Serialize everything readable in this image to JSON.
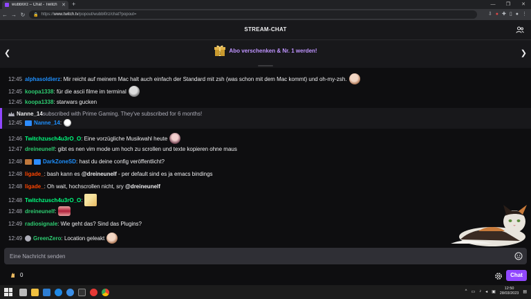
{
  "browser": {
    "tab_title": "wubbl0rz – Chat - Twitch",
    "url_prefix": "https://",
    "url_host": "www.twitch.tv",
    "url_path": "/popout/wubbl0rz/chat?popout="
  },
  "header": {
    "title": "STREAM-CHAT"
  },
  "promo": {
    "text": "Abo verschenken & Nr. 1 werden!"
  },
  "messages": [
    {
      "time": "12:45",
      "user": "alphasoldierz",
      "color": "#1e90ff",
      "text": ": Mir reicht auf meinem Mac halt auch einfach der Standard mit zsh (was schon mit dem Mac kommt) und oh-my-zsh.",
      "emote": "wojak-emote"
    },
    {
      "time": "12:45",
      "user": "koopa1338",
      "color": "#2ecc71",
      "text": ": für die ascii filme im terminal",
      "emote": "pepe-emote"
    },
    {
      "time": "12:45",
      "user": "koopa1338",
      "color": "#2ecc71",
      "text": ": starwars gucken"
    },
    {
      "time": "12:45",
      "user": "Nanne_14",
      "color": "#1e90ff",
      "text": ":",
      "emote": "skull-emote"
    },
    {
      "time": "12:46",
      "user": "Twitchzusch4u3rO_O",
      "color": "#00ff7f",
      "text": ": Eine vorzügliche Musikwahl heute",
      "emote": "anime-emote"
    },
    {
      "time": "12:47",
      "user": "dreineunelf",
      "color": "#2ecc71",
      "text": ": gibt es nen vim mode um hoch zu scrollen und texte kopieren ohne maus"
    },
    {
      "time": "12:48",
      "user": "DarkZoneSD",
      "color": "#1e90ff",
      "text": ": hast du deine config veröffentlicht?"
    },
    {
      "time": "12:48",
      "user": "ligade_",
      "color": "#ff4500",
      "text": ": bash kann es ",
      "mention": "@dreineunelf",
      "text2": " - per default sind es ja emacs bindings"
    },
    {
      "time": "12:48",
      "user": "ligade_",
      "color": "#ff4500",
      "text": ": Oh wait, hochscrollen nicht, sry ",
      "mention": "@dreineunelf"
    },
    {
      "time": "12:48",
      "user": "Twitchzusch4u3rO_O",
      "color": "#00ff7f",
      "text": ":",
      "emote": "blonde-emote"
    },
    {
      "time": "12:48",
      "user": "dreineunelf",
      "color": "#2ecc71",
      "text": ":",
      "emote": "lips-emote"
    },
    {
      "time": "12:49",
      "user": "radiosignale",
      "color": "#2ecc71",
      "text": ": Wie geht das? Sind das Plugins?"
    },
    {
      "time": "12:49",
      "user": "GreenZero",
      "color": "#2ecc71",
      "text": ": Location geleakt",
      "emote": "face-emote"
    }
  ],
  "subscription": {
    "user": "Nanne_14",
    "text": " subscribed with Prime Gaming. They've subscribed for 6 months!"
  },
  "input": {
    "placeholder": "Eine Nachricht senden"
  },
  "points": {
    "value": "0"
  },
  "chat_button": "Chat",
  "taskbar": {
    "time": "12:50",
    "date": "28/03/2023"
  },
  "colors": {
    "accent": "#9147ff",
    "promo": "#bf94ff",
    "background": "#0e0e10"
  }
}
